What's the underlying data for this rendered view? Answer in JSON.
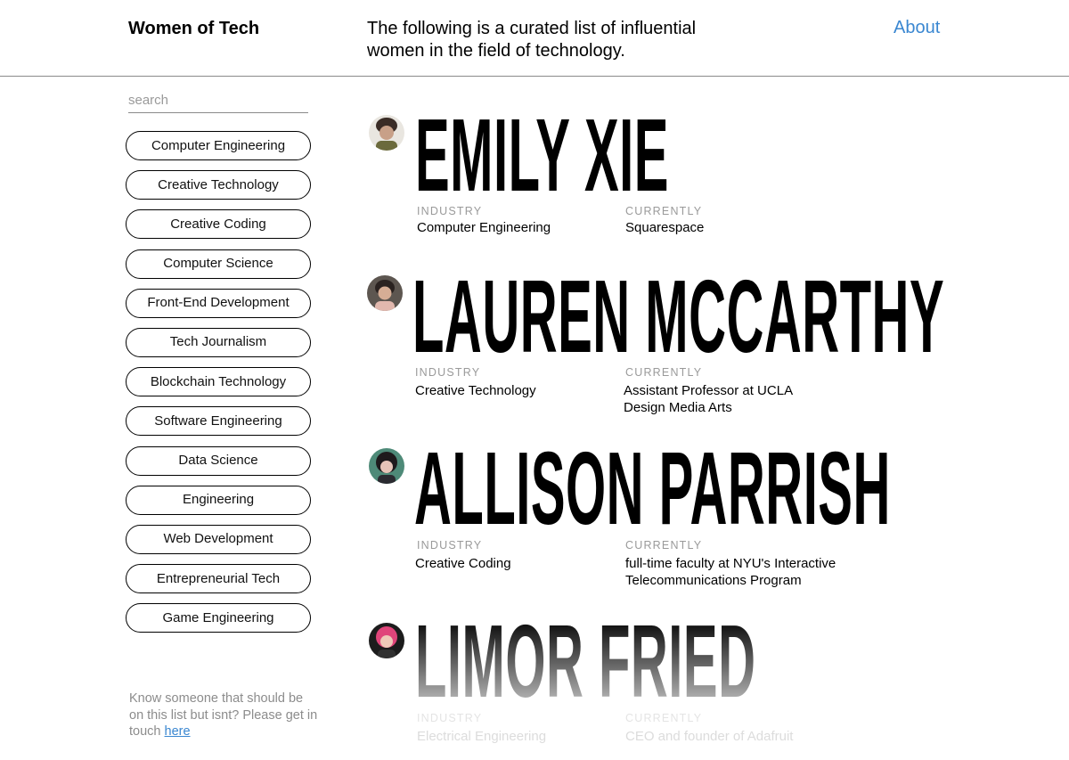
{
  "header": {
    "site_title": "Women of Tech",
    "tagline": "The following is a curated list of influential women in the field of technology.",
    "about_label": "About"
  },
  "sidebar": {
    "search_placeholder": "search",
    "filters": [
      "Computer Engineering",
      "Creative Technology",
      "Creative Coding",
      "Computer Science",
      "Front-End Development",
      "Tech Journalism",
      "Blockchain Technology",
      "Software Engineering",
      "Data Science",
      "Engineering",
      "Web Development",
      "Entrepreneurial Tech",
      "Game Engineering"
    ],
    "footnote_text": "Know someone that should be on this list but isnt? Please get in touch ",
    "footnote_link": "here"
  },
  "people": [
    {
      "name": "EMILY XIE",
      "industry_label": "INDUSTRY",
      "industry": "Computer Engineering",
      "currently_label": "CURRENTLY",
      "currently": "Squarespace"
    },
    {
      "name": "LAUREN MCCARTHY",
      "industry_label": "INDUSTRY",
      "industry": "Creative Technology",
      "currently_label": "CURRENTLY",
      "currently": "Assistant Professor at UCLA Design Media Arts"
    },
    {
      "name": "ALLISON PARRISH",
      "industry_label": "INDUSTRY",
      "industry": "Creative Coding",
      "currently_label": "CURRENTLY",
      "currently": "full-time faculty at NYU's Interactive Telecommunications Program"
    },
    {
      "name": "LIMOR FRIED",
      "industry_label": "INDUSTRY",
      "industry": "Electrical Engineering",
      "currently_label": "CURRENTLY",
      "currently": "CEO and founder of Adafruit"
    }
  ]
}
